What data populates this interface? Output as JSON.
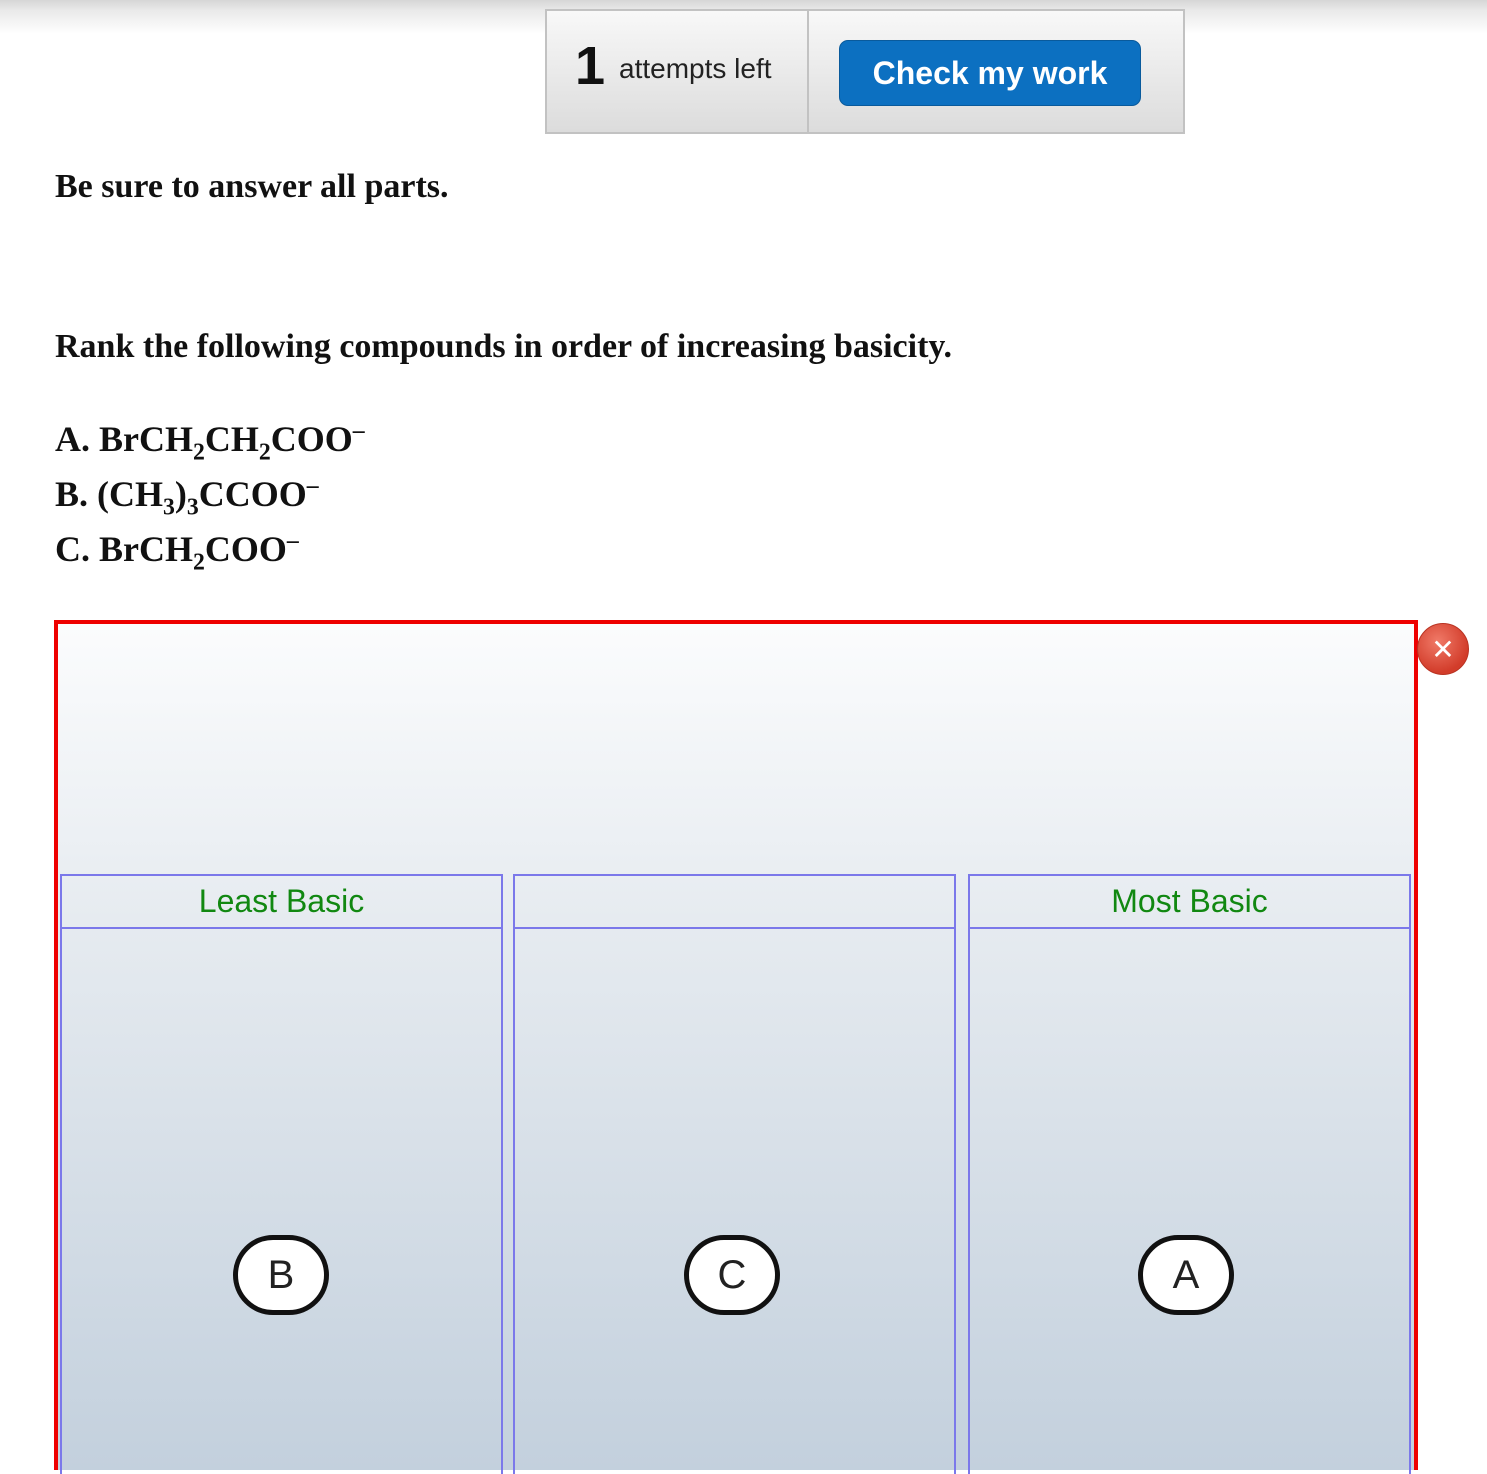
{
  "toolbar": {
    "attempts_count": "1",
    "attempts_label": "attempts left",
    "check_button_label": "Check my work"
  },
  "instructions": "Be sure to answer all parts.",
  "question": "Rank the following compounds in order of increasing basicity.",
  "compounds": [
    {
      "label": "A.",
      "parts": [
        "BrCH",
        "2",
        "CH",
        "2",
        "COO",
        "–"
      ]
    },
    {
      "label": "B.",
      "parts": [
        "(CH",
        "3",
        ")",
        "3",
        "CCOO",
        "–"
      ]
    },
    {
      "label": "C.",
      "parts": [
        "BrCH",
        "2",
        "COO",
        "–"
      ]
    }
  ],
  "ranking": {
    "close_glyph": "✕",
    "columns": [
      {
        "header": "Least Basic",
        "item": "B"
      },
      {
        "header": "",
        "item": "C"
      },
      {
        "header": "Most Basic",
        "item": "A"
      }
    ]
  },
  "colors": {
    "accent": "#0c70c1",
    "error_border": "#ee0000",
    "column_border": "#7b78ea",
    "header_text": "#118811"
  }
}
